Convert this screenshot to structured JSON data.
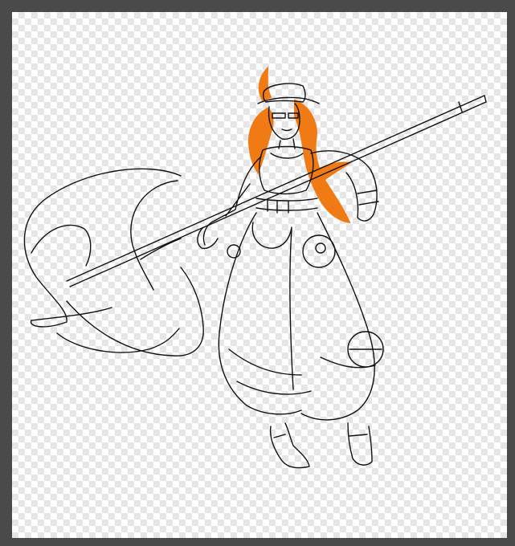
{
  "workspace": {
    "background_color": "#4a4a4a"
  },
  "canvas": {
    "transparency_pattern": "checkerboard",
    "checker_light": "#ffffff",
    "checker_dark": "#e6e6e6"
  },
  "artwork": {
    "subject": "sketch-character-with-battle-axe",
    "line_color": "#111111",
    "hair_color": "#f07a14",
    "layers": [
      "line-sketch",
      "hair-color-fill"
    ]
  }
}
